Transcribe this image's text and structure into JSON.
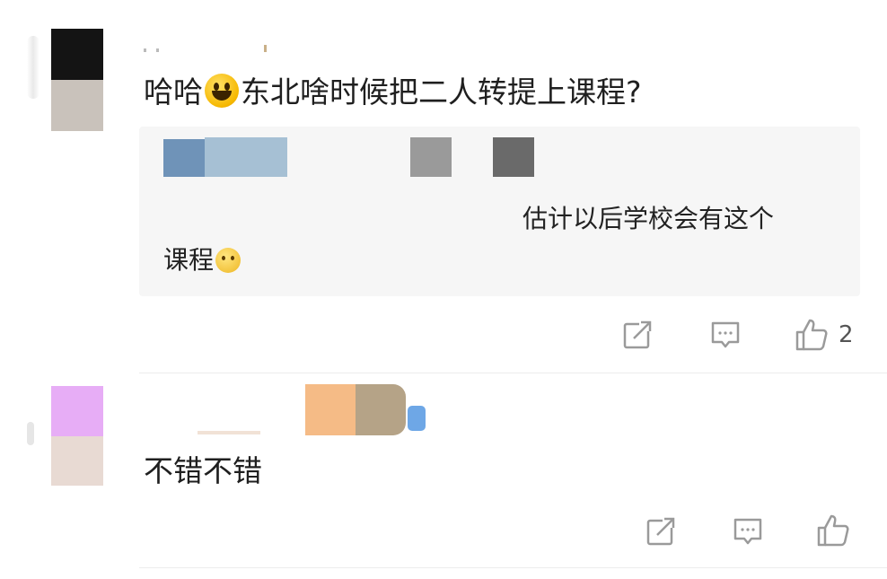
{
  "comments": [
    {
      "text_before_emoji": "哈哈",
      "emoji": "grinning-face-emoji",
      "text_after_emoji": "东北啥时候把二人转提上课程?",
      "quote": {
        "line1": "估计以后学校会有这个",
        "line2": "课程",
        "emoji": "thinking-face-emoji"
      },
      "actions": {
        "share": "share-icon",
        "reply": "comment-icon",
        "like": "thumbs-up-icon",
        "like_count": "2"
      }
    },
    {
      "text": "不错不错",
      "actions": {
        "share": "share-icon",
        "reply": "comment-icon",
        "like": "thumbs-up-icon"
      }
    }
  ],
  "colors": {
    "quote_bg": "#f6f6f6",
    "icon_gray": "#9a9a9a",
    "divider": "#ececec"
  }
}
